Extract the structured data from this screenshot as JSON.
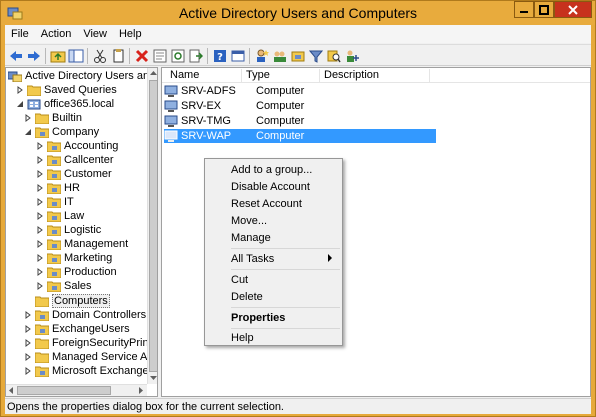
{
  "window": {
    "title": "Active Directory Users and Computers"
  },
  "menubar": {
    "items": [
      "File",
      "Action",
      "View",
      "Help"
    ]
  },
  "toolbar": {
    "buttons": [
      "back-icon",
      "forward-icon",
      "up-folder-icon",
      "show-console-tree-icon",
      "cut-icon",
      "copy-icon",
      "delete-icon",
      "properties-icon",
      "refresh-icon",
      "export-list-icon",
      "help-icon",
      "console-icon",
      "new-user-icon",
      "new-group-icon",
      "filter-icon",
      "add-to-group-icon",
      "find-icon"
    ]
  },
  "tree": {
    "root": "Active Directory Users and Co",
    "saved_queries": "Saved Queries",
    "domain": "office365.local",
    "builtin": "Builtin",
    "company": "Company",
    "company_children": [
      "Accounting",
      "Callcenter",
      "Customer",
      "HR",
      "IT",
      "Law",
      "Logistic",
      "Management",
      "Marketing",
      "Production",
      "Sales"
    ],
    "computers": "Computers",
    "after": [
      "Domain Controllers",
      "ExchangeUsers",
      "ForeignSecurityPrinci",
      "Managed Service Acc",
      "Microsoft Exchange S"
    ]
  },
  "list": {
    "columns": [
      "Name",
      "Type",
      "Description"
    ],
    "rows": [
      {
        "name": "SRV-ADFS",
        "type": "Computer"
      },
      {
        "name": "SRV-EX",
        "type": "Computer"
      },
      {
        "name": "SRV-TMG",
        "type": "Computer"
      },
      {
        "name": "SRV-WAP",
        "type": "Computer"
      }
    ],
    "selected_index": 3
  },
  "context_menu": {
    "items": {
      "add_to_group": "Add to a group...",
      "disable_account": "Disable Account",
      "reset_account": "Reset Account",
      "move": "Move...",
      "manage": "Manage",
      "all_tasks": "All Tasks",
      "cut": "Cut",
      "delete": "Delete",
      "properties": "Properties",
      "help": "Help"
    }
  },
  "status": {
    "text": "Opens the properties dialog box for the current selection."
  },
  "colors": {
    "titlebar": "#e8ab3d",
    "selection": "#3399ff",
    "close": "#c7321d"
  }
}
